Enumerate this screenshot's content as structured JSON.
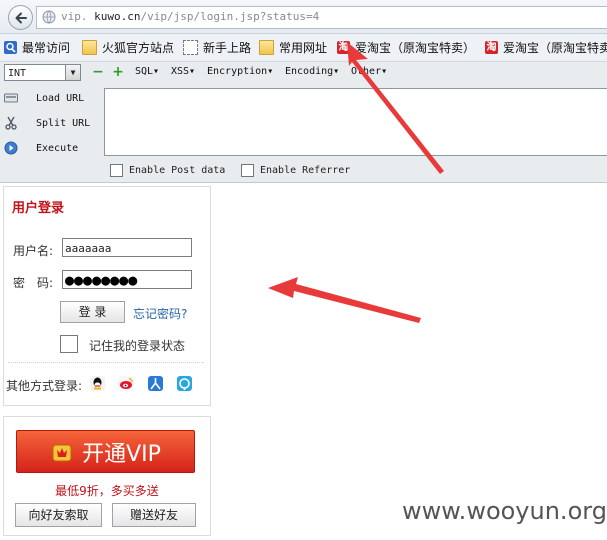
{
  "address_bar": {
    "url_dim_prefix": "vip.",
    "url_domain": "kuwo.cn",
    "url_path": "/vip/jsp/login.jsp?status=4"
  },
  "bookmarks": [
    {
      "label": "最常访问",
      "icon": "search-icon"
    },
    {
      "label": "火狐官方站点",
      "icon": "folder-icon"
    },
    {
      "label": "新手上路",
      "icon": "dashed-folder-icon"
    },
    {
      "label": "常用网址",
      "icon": "folder-icon"
    },
    {
      "label": "爱淘宝（原淘宝特卖）",
      "icon": "taobao-icon"
    },
    {
      "label": "爱淘宝（原淘宝特卖）",
      "icon": "taobao-icon"
    }
  ],
  "taobao_glyph": "淘",
  "hackbar": {
    "select_value": "INT",
    "menus": [
      "SQL▾",
      "XSS▾",
      "Encryption▾",
      "Encoding▾",
      "Other▾"
    ],
    "actions": [
      "Load URL",
      "Split URL",
      "Execute"
    ],
    "checkbox_post": "Enable Post data",
    "checkbox_referrer": "Enable Referrer"
  },
  "login": {
    "title": "用户登录",
    "username_label": "用户名:",
    "username_value": "aaaaaaa",
    "password_label": "密　码:",
    "password_value": "●●●●●●●●",
    "submit_label": "登 录",
    "forgot_label": "忘记密码?",
    "remember_label": "记住我的登录状态",
    "other_login_label": "其他方式登录:"
  },
  "vip": {
    "button_label": "开通VIP",
    "promo": "最低9折，多买多送",
    "ask_friend_label": "向好友索取",
    "gift_friend_label": "赠送好友"
  },
  "watermark": "www.wooyun.org",
  "colors": {
    "brand_red": "#c1121a",
    "arrow_red": "#e83a3a",
    "link_blue": "#2a64a8"
  }
}
